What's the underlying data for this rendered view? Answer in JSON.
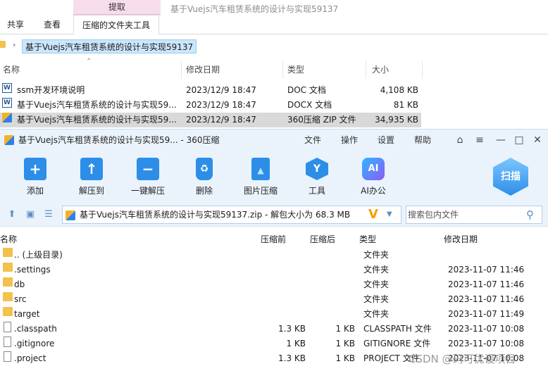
{
  "explorer": {
    "title": "基于Vuejs汽车租赁系统的设计与实现59137",
    "context_tab": "提取",
    "tabs": [
      "共享",
      "查看",
      "压缩的文件夹工具"
    ],
    "address": "基于Vuejs汽车租赁系统的设计与实现59137",
    "columns": [
      "名称",
      "修改日期",
      "类型",
      "大小"
    ],
    "files": [
      {
        "name": "ssm开发环境说明",
        "date": "2023/12/9 18:47",
        "type": "DOC 文档",
        "size": "4,108 KB"
      },
      {
        "name": "基于Vuejs汽车租赁系统的设计与实现59...",
        "date": "2023/12/9 18:47",
        "type": "DOCX 文档",
        "size": "81 KB"
      },
      {
        "name": "基于Vuejs汽车租赁系统的设计与实现59...",
        "date": "2023/12/9 18:47",
        "type": "360压缩 ZIP 文件",
        "size": "34,935 KB"
      }
    ]
  },
  "zip": {
    "title": "基于Vuejs汽车租赁系统的设计与实现59... - 360压缩",
    "menu": [
      "文件",
      "操作",
      "设置",
      "帮助"
    ],
    "toolbar": [
      "添加",
      "解压到",
      "一键解压",
      "删除",
      "图片压缩",
      "工具",
      "AI办公"
    ],
    "scan_label": "扫描",
    "path": "基于Vuejs汽车租赁系统的设计与实现59137.zip - 解包大小为 68.3 MB",
    "search_placeholder": "搜索包内文件",
    "columns": [
      "名称",
      "压缩前",
      "压缩后",
      "类型",
      "修改日期"
    ],
    "entries": [
      {
        "name": ".. (上级目录)",
        "before": "",
        "after": "",
        "type": "文件夹",
        "date": "",
        "kind": "folder"
      },
      {
        "name": ".settings",
        "before": "",
        "after": "",
        "type": "文件夹",
        "date": "2023-11-07 11:46",
        "kind": "folder"
      },
      {
        "name": "db",
        "before": "",
        "after": "",
        "type": "文件夹",
        "date": "2023-11-07 11:46",
        "kind": "folder"
      },
      {
        "name": "src",
        "before": "",
        "after": "",
        "type": "文件夹",
        "date": "2023-11-07 11:46",
        "kind": "folder"
      },
      {
        "name": "target",
        "before": "",
        "after": "",
        "type": "文件夹",
        "date": "2023-11-07 11:49",
        "kind": "folder"
      },
      {
        "name": ".classpath",
        "before": "1.3 KB",
        "after": "1 KB",
        "type": "CLASSPATH 文件",
        "date": "2023-11-07 10:08",
        "kind": "file"
      },
      {
        "name": ".gitignore",
        "before": "1 KB",
        "after": "1 KB",
        "type": "GITIGNORE 文件",
        "date": "2023-11-07 10:08",
        "kind": "file"
      },
      {
        "name": ".project",
        "before": "1.3 KB",
        "after": "1 KB",
        "type": "PROJECT 文件",
        "date": "2023-11-07 10:08",
        "kind": "file"
      }
    ]
  },
  "watermark": "CSDN @码可优设项目"
}
